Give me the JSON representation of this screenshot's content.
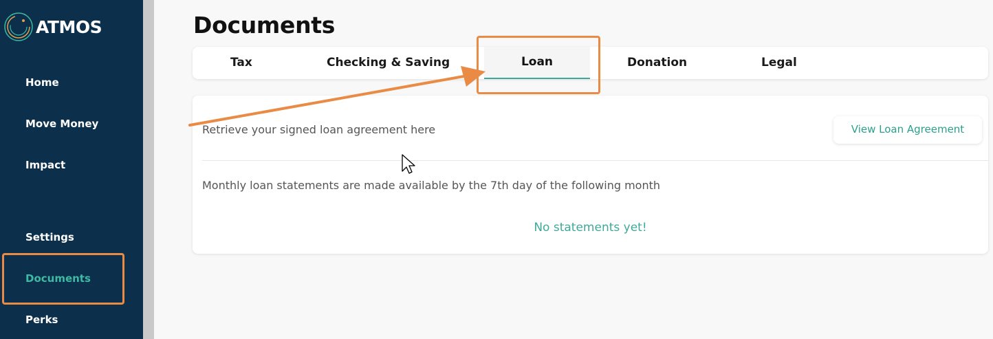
{
  "app": {
    "name": "ATMOS"
  },
  "sidebar": {
    "items": [
      {
        "label": "Home"
      },
      {
        "label": "Move Money"
      },
      {
        "label": "Impact"
      },
      {
        "label": "Settings"
      },
      {
        "label": "Documents",
        "active": true
      },
      {
        "label": "Perks"
      }
    ]
  },
  "page": {
    "title": "Documents"
  },
  "tabs": [
    {
      "label": "Tax"
    },
    {
      "label": "Checking & Saving"
    },
    {
      "label": "Loan",
      "active": true
    },
    {
      "label": "Donation"
    },
    {
      "label": "Legal"
    }
  ],
  "loan": {
    "agreement_text": "Retrieve your signed loan agreement here",
    "view_button_label": "View Loan Agreement",
    "statements_text": "Monthly loan statements are made available by the 7th day of the following month",
    "empty_message": "No statements yet!"
  },
  "colors": {
    "sidebar_bg": "#0c2f4c",
    "accent": "#3fb9a2",
    "annotation": "#e98b45"
  },
  "icons": {
    "logo": "atmos-logo-icon",
    "cursor": "mouse-pointer-icon"
  }
}
